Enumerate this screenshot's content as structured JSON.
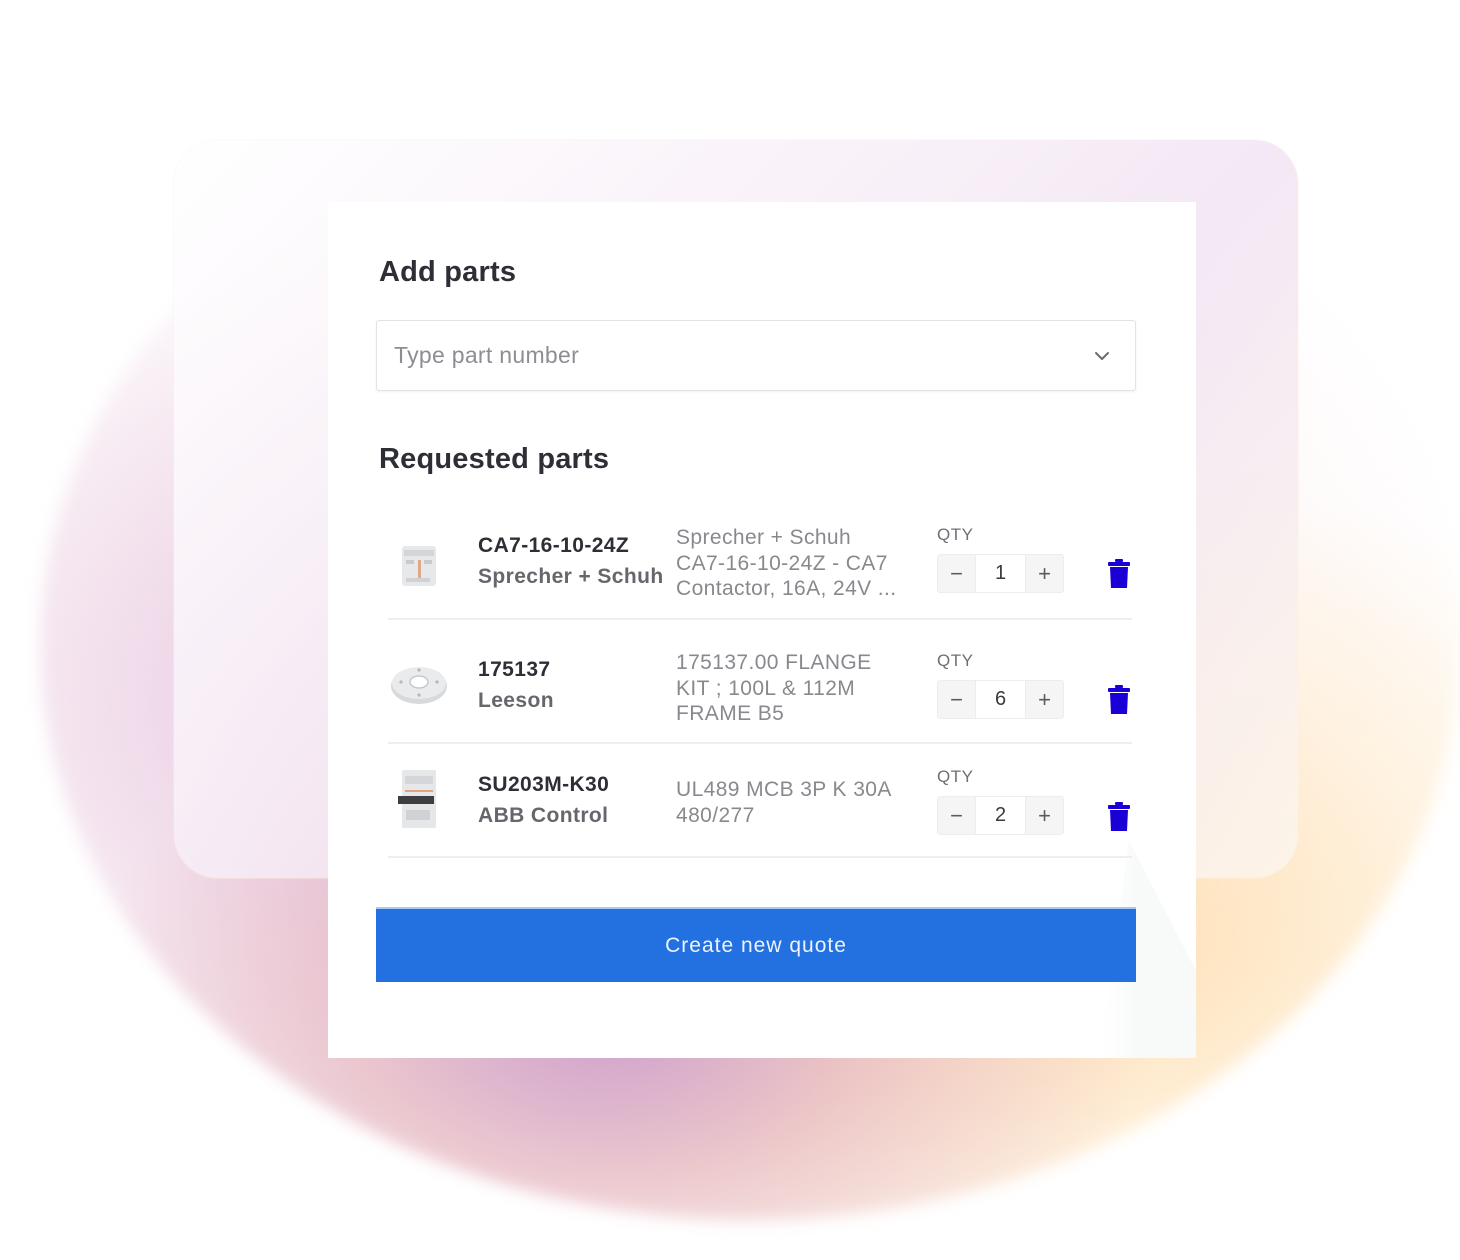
{
  "add_parts": {
    "title": "Add parts",
    "search": {
      "placeholder": "Type part number",
      "value": "",
      "icon": "chevron-down-icon"
    }
  },
  "requested_parts": {
    "title": "Requested parts",
    "qty_label": "QTY",
    "items": [
      {
        "part_number": "CA7-16-10-24Z",
        "manufacturer": "Sprecher + Schuh",
        "description_lines": [
          "Sprecher + Schuh",
          "CA7-16-10-24Z - CA7",
          "Contactor, 16A, 24V ..."
        ],
        "quantity": "1",
        "thumbnail": "contactor-image"
      },
      {
        "part_number": "175137",
        "manufacturer": "Leeson",
        "description_lines": [
          "175137.00 FLANGE",
          "KIT ; 100L & 112M",
          "FRAME B5"
        ],
        "quantity": "6",
        "thumbnail": "flange-image"
      },
      {
        "part_number": "SU203M-K30",
        "manufacturer": "ABB Control",
        "description_lines": [
          "UL489 MCB 3P K 30A",
          "480/277"
        ],
        "quantity": "2",
        "thumbnail": "breaker-image"
      }
    ],
    "decrement_symbol": "−",
    "increment_symbol": "+"
  },
  "cta": {
    "label": "Create new quote"
  },
  "colors": {
    "primary": "#2370e0",
    "trash": "#1a00d6",
    "heading": "#2e2f36"
  }
}
